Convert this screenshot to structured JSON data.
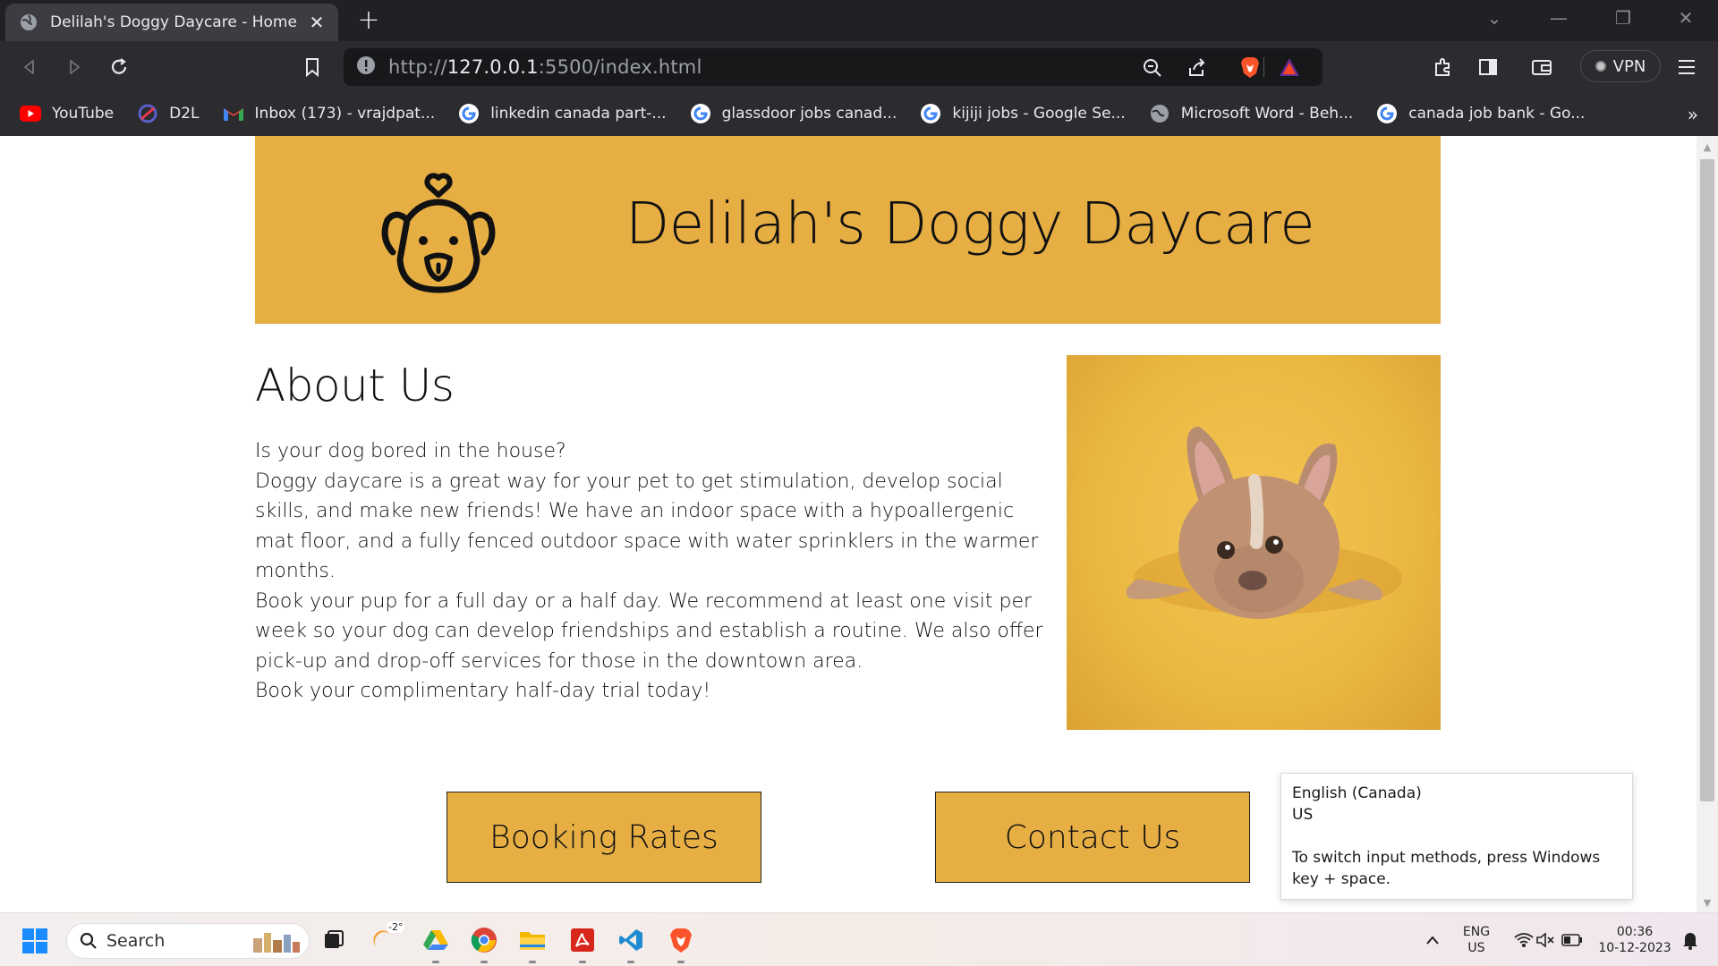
{
  "browser": {
    "tab_title": "Delilah's Doggy Daycare - Home",
    "url_prefix": "http://",
    "url_host": "127.0.0.1",
    "url_rest": ":5500/index.html",
    "vpn_label": "VPN"
  },
  "bookmarks": [
    {
      "label": "YouTube",
      "icon": "youtube-icon"
    },
    {
      "label": "D2L",
      "icon": "d2l-icon"
    },
    {
      "label": "Inbox (173) - vrajdpat...",
      "icon": "gmail-icon"
    },
    {
      "label": "linkedin canada part-...",
      "icon": "google-icon"
    },
    {
      "label": "glassdoor jobs canad...",
      "icon": "google-icon"
    },
    {
      "label": "kijiji jobs - Google Se...",
      "icon": "google-icon"
    },
    {
      "label": "Microsoft Word - Beh...",
      "icon": "globe-icon"
    },
    {
      "label": "canada job bank - Go...",
      "icon": "google-icon"
    }
  ],
  "page": {
    "site_title": "Delilah's Doggy Daycare",
    "about_heading": "About Us",
    "about_paragraphs": [
      "Is your dog bored in the house?",
      "Doggy daycare is a great way for your pet to get stimulation, develop social skills, and make new friends! We have an indoor space with a hypoallergenic mat floor, and a fully fenced outdoor space with water sprinklers in the warmer months.",
      "Book your pup for a full day or a half day. We recommend at least one visit per week so your dog can develop friendships and establish a routine. We also offer pick-up and drop-off services for those in the downtown area.",
      "Book your complimentary half-day trial today!"
    ],
    "booking_button": "Booking Rates",
    "contact_button": "Contact Us",
    "accent_color": "#e6ae43"
  },
  "tooltip": {
    "line1": "English (Canada)",
    "line2": "US",
    "line3": "To switch input methods, press Windows key + space."
  },
  "taskbar": {
    "search_label": "Search",
    "weather_temp": "-2°",
    "lang_top": "ENG",
    "lang_bottom": "US",
    "time": "00:36",
    "date": "10-12-2023"
  }
}
